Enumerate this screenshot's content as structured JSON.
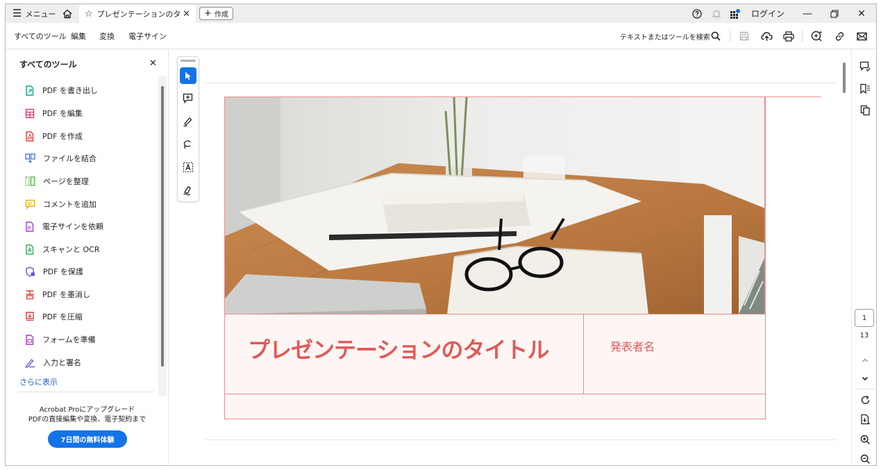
{
  "titlebar": {
    "menu_label": "メニュー",
    "tab_title": "プレゼンテーションのタイ…",
    "new_label": "作成",
    "login_label": "ログイン",
    "icons": [
      "menu-icon",
      "home-icon",
      "star-icon",
      "close-icon",
      "plus-icon",
      "help-icon",
      "bell-icon",
      "apps-icon",
      "minimize-icon",
      "maximize-icon",
      "close-window-icon"
    ]
  },
  "toolbar": {
    "tabs": [
      "すべてのツール",
      "編集",
      "変換",
      "電子サイン"
    ],
    "search_label": "テキストまたはツールを検索",
    "icons": [
      "search-icon",
      "save-icon",
      "upload-icon",
      "print-icon",
      "ai-assistant-icon",
      "link-icon",
      "mail-icon"
    ]
  },
  "left_panel": {
    "title": "すべてのツール",
    "tools": [
      {
        "label": "PDF を書き出し",
        "color": "#1a9e8c"
      },
      {
        "label": "PDF を編集",
        "color": "#e0347a"
      },
      {
        "label": "PDF を作成",
        "color": "#e03c3c"
      },
      {
        "label": "ファイルを結合",
        "color": "#3f6fd8"
      },
      {
        "label": "ページを整理",
        "color": "#4caf3a"
      },
      {
        "label": "コメントを追加",
        "color": "#e6b400"
      },
      {
        "label": "電子サインを依頼",
        "color": "#a03cc8"
      },
      {
        "label": "スキャンと OCR",
        "color": "#3aa85a"
      },
      {
        "label": "PDF を保護",
        "color": "#6b4fd8"
      },
      {
        "label": "PDF を墨消し",
        "color": "#e03c3c"
      },
      {
        "label": "PDF を圧縮",
        "color": "#e03c3c"
      },
      {
        "label": "フォームを準備",
        "color": "#a03cc8"
      },
      {
        "label": "入力と署名",
        "color": "#6b4fd8"
      }
    ],
    "more_label": "さらに表示",
    "upgrade_line1": "Acrobat Proにアップグレード",
    "upgrade_line2": "PDFの直接編集や変換、電子契約まで",
    "trial_button": "7日間の無料体験"
  },
  "vertical_tools": [
    "select-cursor-icon",
    "add-comment-icon",
    "highlight-pen-icon",
    "draw-lasso-icon",
    "text-select-icon",
    "sign-pen-icon"
  ],
  "slide": {
    "title": "プレゼンテーションのタイトル",
    "presenter": "発表者名",
    "accent_color": "#e05a57",
    "photo": "desk-with-glasses-and-notebooks"
  },
  "right_rail": {
    "top_icons": [
      "comment-icon",
      "bookmark-icon",
      "pages-icon"
    ],
    "current_page": "1",
    "total_pages": "13",
    "bottom_icons": [
      "chevron-up-icon",
      "chevron-down-icon",
      "rotate-icon",
      "page-extract-icon",
      "zoom-in-icon",
      "zoom-out-icon"
    ]
  }
}
